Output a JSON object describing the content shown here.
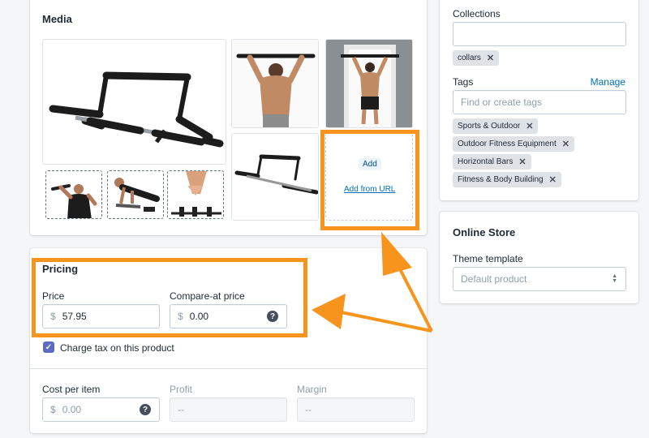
{
  "media": {
    "title": "Media",
    "add_button": "Add",
    "add_from_url": "Add from URL",
    "images": [
      "pull-up-bar-main",
      "man-using-pull-up-bar-back",
      "man-hanging-in-doorway",
      "man-using-bar-front",
      "man-doing-pushups",
      "bar-parts",
      "pull-up-bar-side"
    ]
  },
  "pricing": {
    "title": "Pricing",
    "price_label": "Price",
    "price_prefix": "$",
    "price_value": "57.95",
    "compare_label": "Compare-at price",
    "compare_prefix": "$",
    "compare_value": "0.00",
    "help_icon": "?",
    "charge_tax_label": "Charge tax on this product",
    "cost_label": "Cost per item",
    "cost_prefix": "$",
    "cost_placeholder": "0.00",
    "profit_label": "Profit",
    "profit_value": "--",
    "margin_label": "Margin",
    "margin_value": "--"
  },
  "organization": {
    "collections_label": "Collections",
    "collection_tags": [
      "collars"
    ],
    "tags_label": "Tags",
    "manage_link": "Manage",
    "tags_placeholder": "Find or create tags",
    "tags": [
      "Sports & Outdoor",
      "Outdoor Fitness Equipment",
      "Horizontal Bars",
      "Fitness & Body Building"
    ]
  },
  "online_store": {
    "title": "Online Store",
    "theme_label": "Theme template",
    "theme_value": "Default product"
  },
  "colors": {
    "highlight": "#f7941d",
    "link": "#006fbb",
    "checkbox": "#5c6ac4"
  }
}
